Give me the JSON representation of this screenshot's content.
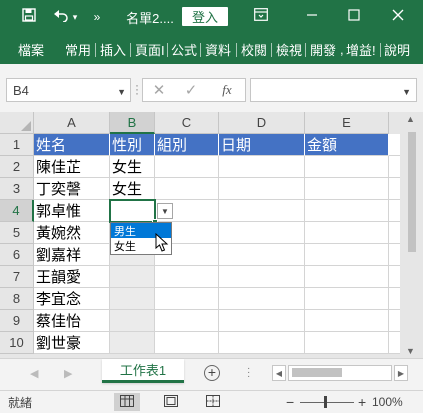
{
  "titlebar": {
    "filename": "名單2....",
    "login_label": "登入",
    "undo_dropdown": "▾",
    "more_glyph": "»",
    "ribbon_options_glyph": "⊡",
    "minimize_glyph": "─",
    "maximize_glyph": "☐",
    "close_glyph": "✕",
    "background": "#217346"
  },
  "ribbon": {
    "tabs": [
      {
        "label": "檔案"
      },
      {
        "label": "常用"
      },
      {
        "label": "插入"
      },
      {
        "label": "頁面I"
      },
      {
        "label": "公式"
      },
      {
        "label": "資料"
      },
      {
        "label": "校閱"
      },
      {
        "label": "檢視"
      },
      {
        "label": "開發"
      },
      {
        "label": "增益!"
      },
      {
        "label": "說明"
      }
    ]
  },
  "formula_bar": {
    "name_box": "B4",
    "cancel_glyph": "✕",
    "enter_glyph": "✓",
    "function_glyph": "fx",
    "formula_value": ""
  },
  "sheet": {
    "columns": [
      "A",
      "B",
      "C",
      "D",
      "E"
    ],
    "rows": [
      "1",
      "2",
      "3",
      "4",
      "5",
      "6",
      "7",
      "8",
      "9",
      "10"
    ],
    "cells": {
      "A1": "姓名",
      "B1": "性別",
      "C1": "組別",
      "D1": "日期",
      "E1": "金額",
      "A2": "陳佳芷",
      "B2": "女生",
      "A3": "丁奕謦",
      "B3": "女生",
      "A4": "郭卓惟",
      "A5": "黃婉然",
      "A6": "劉嘉祥",
      "A7": "王韻愛",
      "A8": "李宜念",
      "A9": "蔡佳怡",
      "A10": "劉世豪"
    },
    "active_cell": "B4",
    "header_fill": "#4472c4",
    "accent": "#217346"
  },
  "dropdown": {
    "options": [
      "男生",
      "女生"
    ],
    "highlighted_index": 0,
    "highlight_color": "#0078d7"
  },
  "sheet_tabs": {
    "tabs": [
      "工作表1"
    ],
    "add_glyph": "+"
  },
  "status": {
    "ready_label": "就緒",
    "zoom_minus": "−",
    "zoom_plus": "+",
    "zoom_level": "100%"
  }
}
